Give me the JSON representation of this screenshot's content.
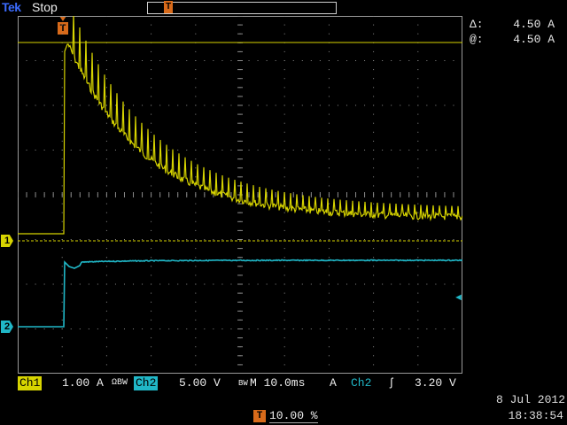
{
  "header": {
    "brand": "Tek",
    "run_state": "Stop"
  },
  "cursors": {
    "delta_symbol": "Δ:",
    "delta_value": "4.50 A",
    "at_symbol": "@:",
    "at_value": "4.50 A"
  },
  "channels": {
    "ch1_marker": "1",
    "ch2_marker": "2"
  },
  "trigger": {
    "marker": "T",
    "level_arrow": "◄"
  },
  "status": {
    "ch1_label": "Ch1",
    "ch1_scale": "1.00 A",
    "ch1_coupling": "ΩBW",
    "ch2_label": "Ch2",
    "ch2_scale": "5.00 V",
    "bw_mark": "BW",
    "timebase": "M 10.0ms",
    "trig_mode": "A",
    "trig_source": "Ch2",
    "trig_slope": "ʃ",
    "trig_level": "3.20 V",
    "date": "8 Jul 2012",
    "time": "18:38:54",
    "position": "10.00 %"
  },
  "colors": {
    "ch1": "#d7d400",
    "ch2": "#20b7c7",
    "trigger": "#d86a1a",
    "graticule": "#a0a0a0"
  }
}
